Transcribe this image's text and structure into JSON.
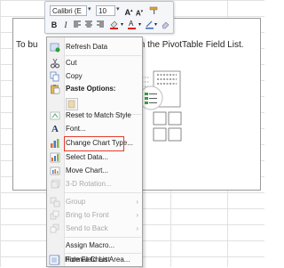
{
  "chart": {
    "message_left": "To bu",
    "message_right": "ds from the PivotTable Field List."
  },
  "toolbar": {
    "font_name": "Calibri (E",
    "font_size": "10",
    "grow_font": "A",
    "shrink_font": "A",
    "bold": "B",
    "italic": "I"
  },
  "menu": {
    "items": [
      {
        "label": "Refresh Data",
        "icon": "refresh-icon",
        "enabled": true
      },
      {
        "label": "Cut",
        "icon": "scissors-icon",
        "enabled": true
      },
      {
        "label": "Copy",
        "icon": "copy-icon",
        "enabled": true
      },
      {
        "label": "Paste Options:",
        "icon": "paste-icon",
        "enabled": true
      },
      {
        "label": "Reset to Match Style",
        "icon": "reset-style-icon",
        "enabled": true
      },
      {
        "label": "Font...",
        "icon": "font-icon",
        "enabled": true
      },
      {
        "label": "Change Chart Type...",
        "icon": "chart-type-icon",
        "enabled": true
      },
      {
        "label": "Select Data...",
        "icon": "select-data-icon",
        "enabled": true
      },
      {
        "label": "Move Chart...",
        "icon": "move-chart-icon",
        "enabled": true
      },
      {
        "label": "3-D Rotation...",
        "icon": "rotation-3d-icon",
        "enabled": false
      },
      {
        "label": "Group",
        "icon": "group-icon",
        "enabled": false
      },
      {
        "label": "Bring to Front",
        "icon": "bring-front-icon",
        "enabled": false
      },
      {
        "label": "Send to Back",
        "icon": "send-back-icon",
        "enabled": false
      },
      {
        "label": "Assign Macro...",
        "icon": "macro-icon",
        "enabled": true
      },
      {
        "label": "Format Chart Area...",
        "icon": "format-area-icon",
        "enabled": true
      },
      {
        "label": "Hide Field List",
        "icon": "field-list-icon",
        "enabled": true
      }
    ]
  },
  "colors": {
    "highlight_border": "#e53b2c",
    "menu_bg": "#fbfbfb",
    "disabled_text": "#a8a8a8"
  }
}
